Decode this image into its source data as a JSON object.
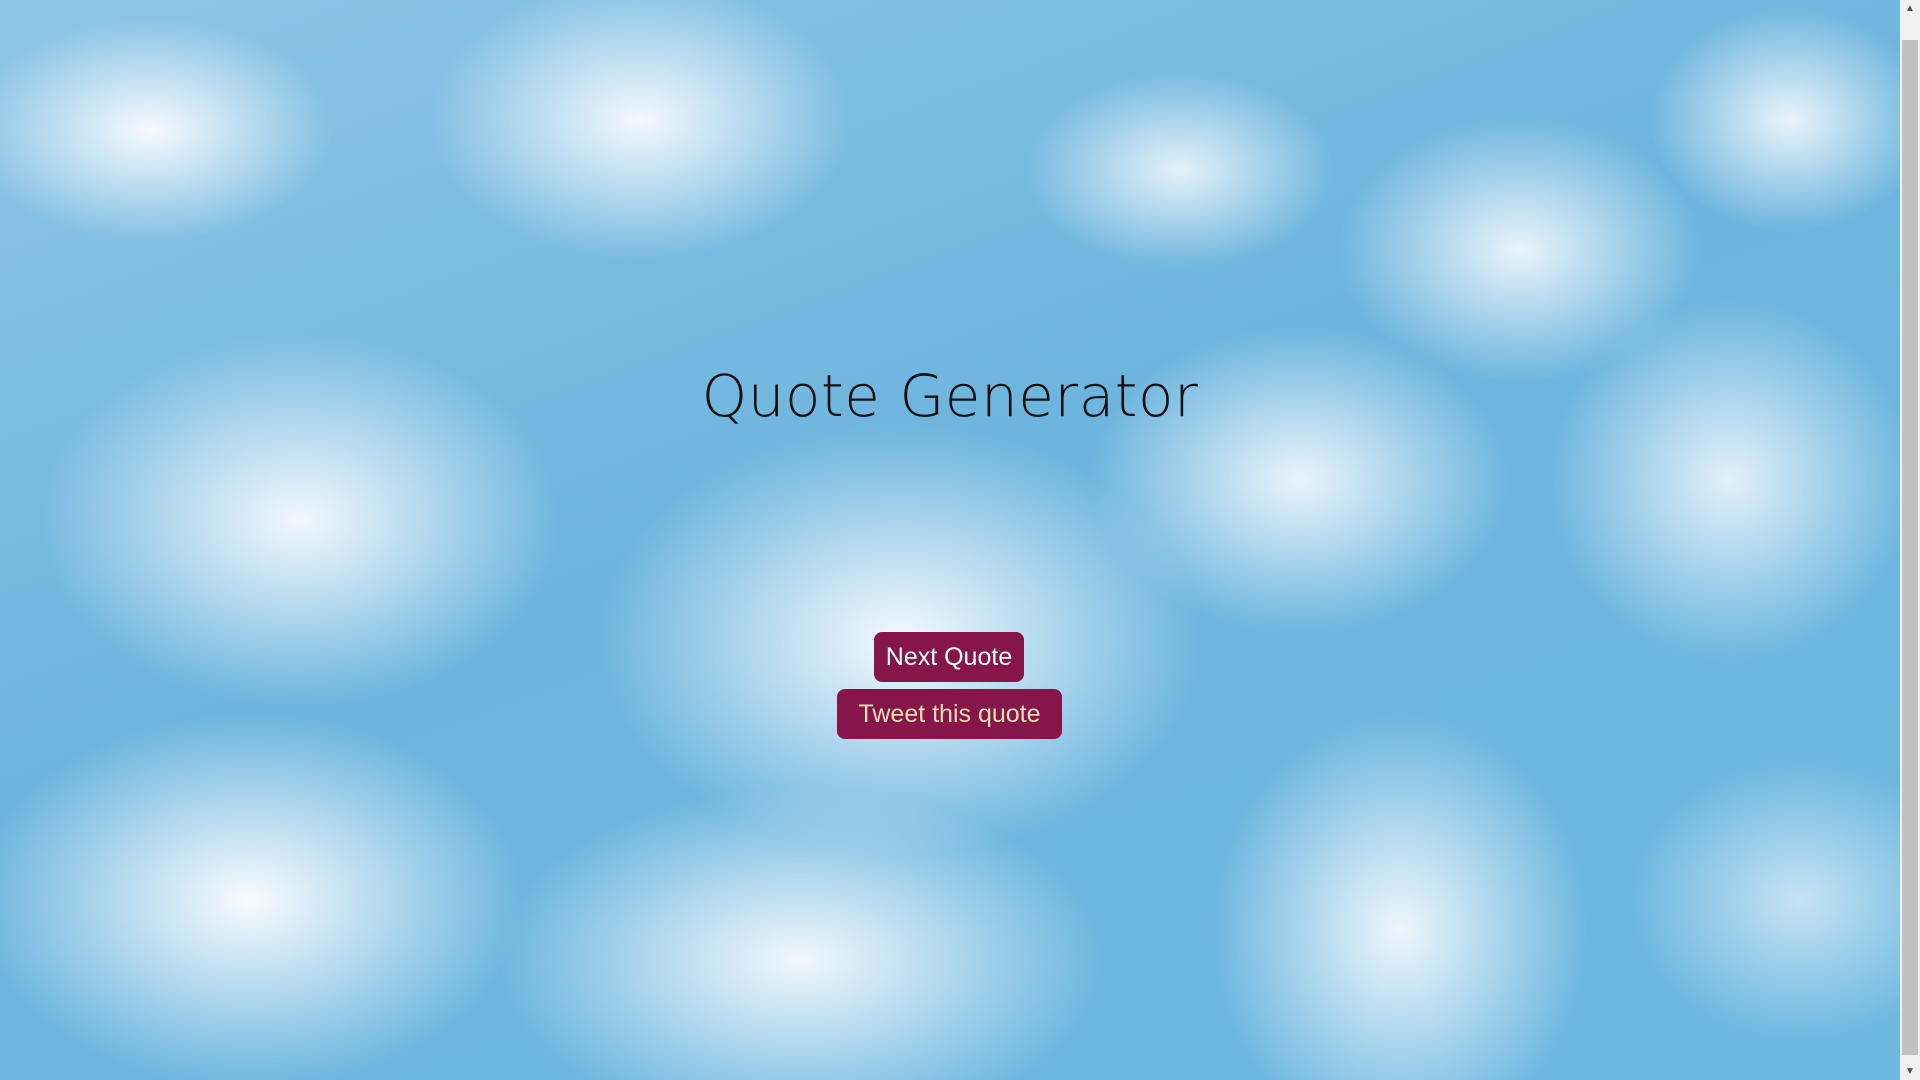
{
  "page": {
    "title": "Quote Generator"
  },
  "buttons": {
    "next_label": "Next Quote",
    "tweet_label": "Tweet this quote"
  },
  "scrollbar": {
    "up_icon": "▲",
    "down_icon": "▼"
  },
  "colors": {
    "button_bg": "#86164a",
    "next_text": "#ffffff",
    "tweet_text": "#f7ddb0",
    "sky": "#6cb4dc"
  }
}
